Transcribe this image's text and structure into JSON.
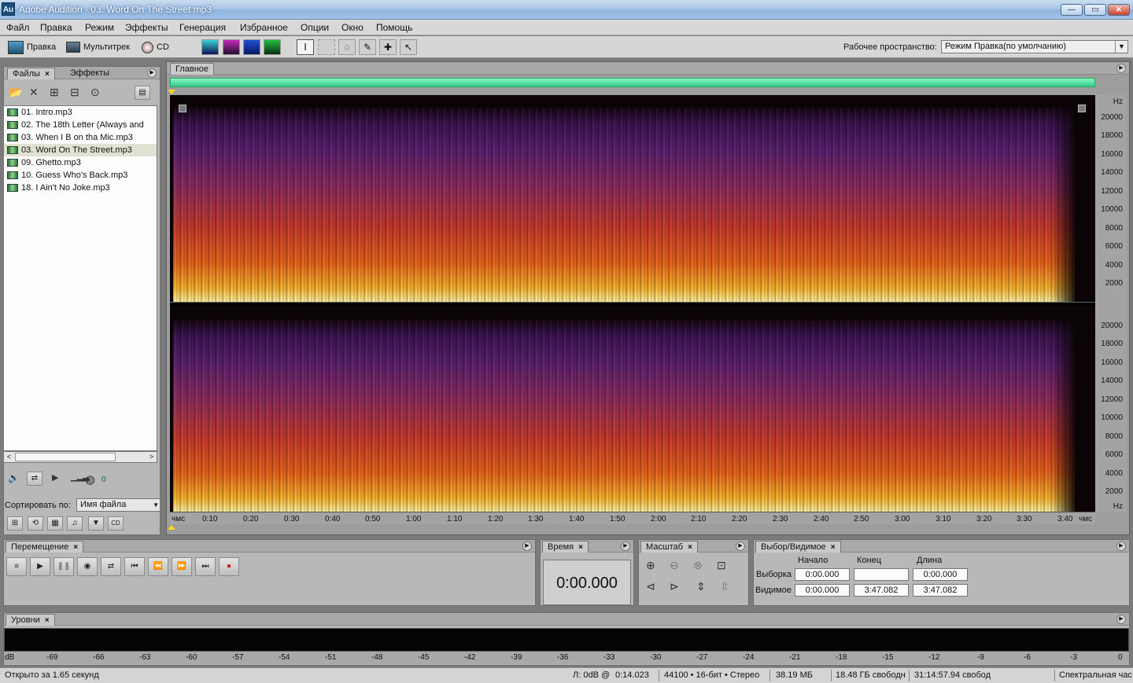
{
  "window": {
    "app_icon": "Au",
    "title": "Adobe Audition - 03. Word On The Street.mp3",
    "buttons": {
      "minimize": "—",
      "maximize": "▭",
      "close": "✕"
    }
  },
  "menu": [
    "Файл",
    "Правка",
    "Режим",
    "Эффекты",
    "Генерация",
    "Избранное",
    "Опции",
    "Окно",
    "Помощь"
  ],
  "toolbar": {
    "modes": [
      "Правка",
      "Мультитрек",
      "CD"
    ],
    "workspace_label": "Рабочее пространство:",
    "workspace_value": "Режим Правка(по умолчанию)"
  },
  "files_panel": {
    "tabs": [
      "Файлы",
      "Эффекты"
    ],
    "files": [
      "01. Intro.mp3",
      "02. The 18th Letter (Always and",
      "03. When I B on tha Mic.mp3",
      "03. Word On The Street.mp3",
      "09. Ghetto.mp3",
      "10. Guess Who's Back.mp3",
      "18. I Ain't No Joke.mp3"
    ],
    "selected_index": 3,
    "volume_value": "0",
    "sort_label": "Сортировать по:",
    "sort_value": "Имя файла"
  },
  "editor": {
    "tab": "Главное",
    "hz_unit": "Hz",
    "hz_labels": [
      "20000",
      "18000",
      "16000",
      "14000",
      "12000",
      "10000",
      "8000",
      "6000",
      "4000",
      "2000"
    ],
    "time_start_label": "чмс",
    "time_end_label": "чмс",
    "time_labels": [
      "0:10",
      "0:20",
      "0:30",
      "0:40",
      "0:50",
      "1:00",
      "1:10",
      "1:20",
      "1:30",
      "1:40",
      "1:50",
      "2:00",
      "2:10",
      "2:20",
      "2:30",
      "2:40",
      "2:50",
      "3:00",
      "3:10",
      "3:20",
      "3:30",
      "3:40"
    ]
  },
  "transport": {
    "tab": "Перемещение"
  },
  "time_panel": {
    "tab": "Время",
    "value": "0:00.000"
  },
  "zoom_panel": {
    "tab": "Масштаб"
  },
  "selection_panel": {
    "tab": "Выбор/Видимое",
    "headers": [
      "Начало",
      "Конец",
      "Длина"
    ],
    "rows": [
      {
        "label": "Выборка",
        "start": "0:00.000",
        "end": "",
        "length": "0:00.000"
      },
      {
        "label": "Видимое",
        "start": "0:00.000",
        "end": "3:47.082",
        "length": "3:47.082"
      }
    ]
  },
  "levels": {
    "tab": "Уровни",
    "scale": [
      "dB",
      "-69",
      "-66",
      "-63",
      "-60",
      "-57",
      "-54",
      "-51",
      "-48",
      "-45",
      "-42",
      "-39",
      "-36",
      "-33",
      "-30",
      "-27",
      "-24",
      "-21",
      "-18",
      "-15",
      "-12",
      "-9",
      "-6",
      "-3",
      "0"
    ]
  },
  "status": {
    "opened": "Открыто за 1.65 секунд",
    "level": "Л: 0dB @",
    "position": "0:14.023",
    "format": "44100 • 16-бит • Стерео",
    "size": "38.19 МБ",
    "free_space": "18.48 ГБ свободн",
    "free_time": "31:14:57.94 свобод",
    "view": "Спектральная час"
  }
}
